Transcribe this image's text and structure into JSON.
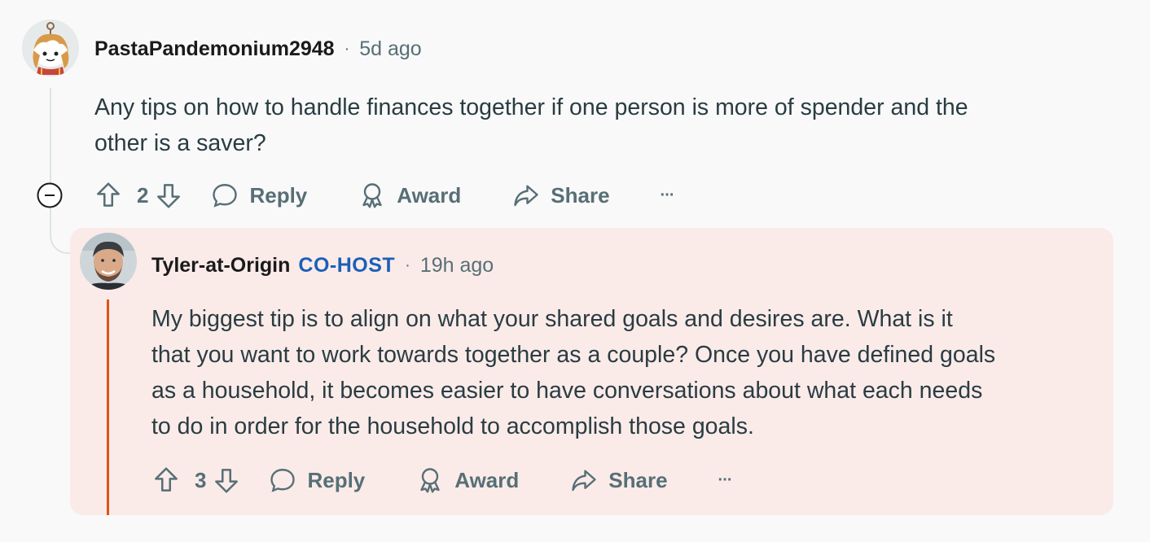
{
  "comment": {
    "username": "PastaPandemonium2948",
    "separator": "·",
    "time": "5d ago",
    "body_line1": "Any tips on how to handle finances together if one person is more of spender and the",
    "body_line2": "other is a saver?",
    "votes": "2",
    "actions": {
      "reply": "Reply",
      "award": "Award",
      "share": "Share",
      "more": "···"
    }
  },
  "reply": {
    "username": "Tyler-at-Origin",
    "flair": "CO-HOST",
    "separator": "·",
    "time": "19h ago",
    "body_lines": [
      "My biggest tip is to align on what your shared goals and desires are. What is it",
      "that you want to work towards together as a couple? Once you have defined goals",
      "as a household, it becomes easier to have conversations about what each needs",
      "to do in order for the household to accomplish those goals."
    ],
    "votes": "3",
    "actions": {
      "reply": "Reply",
      "award": "Award",
      "share": "Share",
      "more": "···"
    }
  },
  "colors": {
    "background": "#f9f9f9",
    "reply_highlight": "#faebe9",
    "moderator_bar": "#e0521a",
    "flair": "#1c5fb8",
    "meta": "#576f76"
  },
  "icons": [
    "upvote-icon",
    "downvote-icon",
    "comment-bubble-icon",
    "award-ribbon-icon",
    "share-arrow-icon",
    "collapse-minus-icon",
    "more-dots-icon"
  ]
}
